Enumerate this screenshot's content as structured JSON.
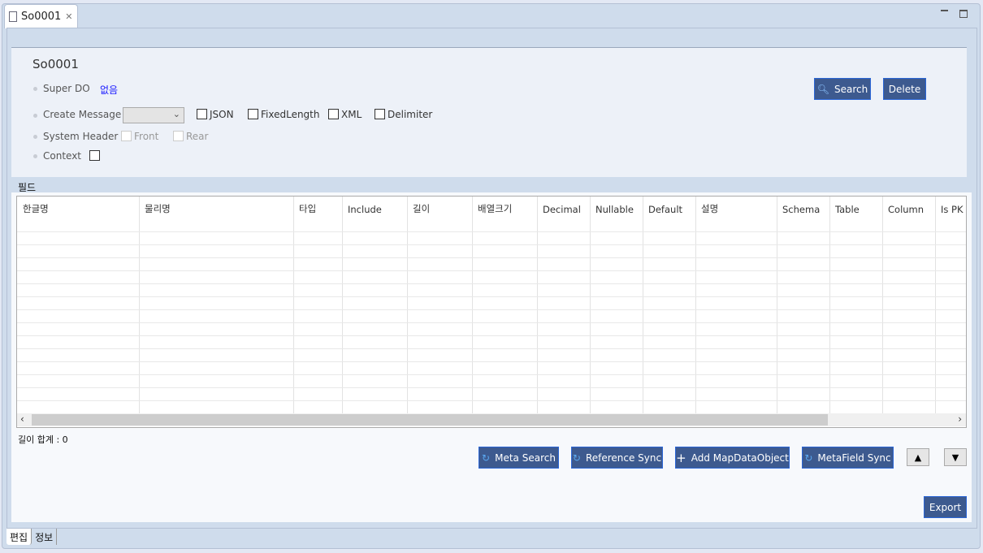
{
  "tab": {
    "title": "So0001",
    "icon": "class-file-icon",
    "close_icon": "close-icon"
  },
  "window_controls": {
    "minimize": "minimize-icon",
    "maximize": "maximize-icon"
  },
  "header": {
    "title": "So0001",
    "super_do": {
      "label": "Super DO",
      "value": "없음"
    },
    "create_message": {
      "label": "Create Message",
      "select_value": "",
      "options": [
        {
          "label": "JSON",
          "checked": false
        },
        {
          "label": "FixedLength",
          "checked": false
        },
        {
          "label": "XML",
          "checked": false
        },
        {
          "label": "Delimiter",
          "checked": false
        }
      ]
    },
    "system_header": {
      "label": "System Header",
      "options": [
        {
          "label": "Front",
          "checked": false,
          "disabled": true
        },
        {
          "label": "Rear",
          "checked": false,
          "disabled": true
        }
      ]
    },
    "context": {
      "label": "Context",
      "checked": false
    },
    "search_label": "Search",
    "delete_label": "Delete"
  },
  "fields": {
    "section_label": "필드",
    "columns": [
      "한글명",
      "물리명",
      "타입",
      "Include",
      "길이",
      "배열크기",
      "Decimal",
      "Nullable",
      "Default",
      "설명",
      "Schema",
      "Table",
      "Column",
      "Is PK"
    ],
    "rows": [],
    "length_total": "길이 합계 : 0"
  },
  "actions": {
    "meta_search": "Meta Search",
    "reference_sync": "Reference Sync",
    "add_mapdataobject": "Add MapDataObject",
    "metafield_sync": "MetaField Sync",
    "move_up": "▲",
    "move_down": "▼",
    "export": "Export"
  },
  "bottom_tabs": [
    "편집",
    "정보"
  ],
  "colors": {
    "button": "#3d5a8f",
    "link": "#1a1aff",
    "panel": "#cfdcec"
  }
}
